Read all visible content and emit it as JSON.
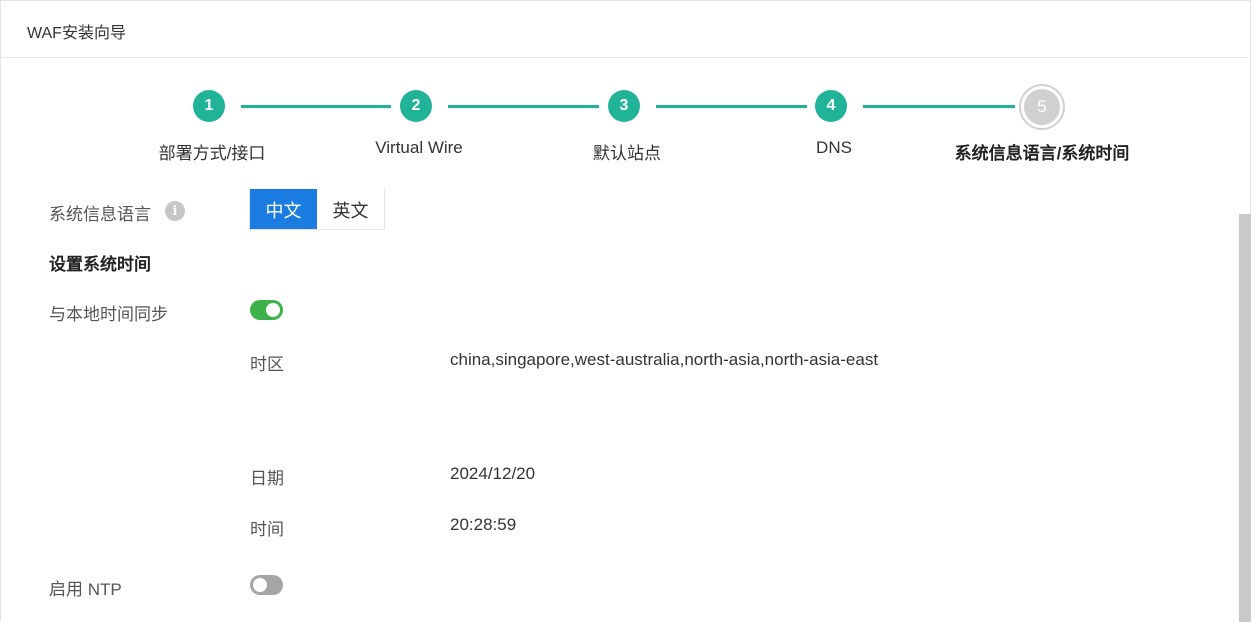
{
  "header": {
    "title": "WAF安装向导"
  },
  "steps": [
    {
      "number": "1",
      "label": "部署方式/接口",
      "state": "done"
    },
    {
      "number": "2",
      "label": "Virtual Wire",
      "state": "done"
    },
    {
      "number": "3",
      "label": "默认站点",
      "state": "done"
    },
    {
      "number": "4",
      "label": "DNS",
      "state": "done"
    },
    {
      "number": "5",
      "label": "系统信息语言/系统时间",
      "state": "current"
    }
  ],
  "colors": {
    "accent": "#20b398",
    "selected": "#1a7ce0",
    "toggle_on": "#3db24b",
    "toggle_off": "#a5a5a5",
    "pending": "#d0d0d0"
  },
  "language": {
    "label": "系统信息语言",
    "info_icon": "info-icon",
    "options": [
      "中文",
      "英文"
    ],
    "selected": "中文"
  },
  "time_section": {
    "heading": "设置系统时间",
    "sync_label": "与本地时间同步",
    "sync_enabled": true,
    "timezone_label": "时区",
    "timezone_value": "china,singapore,west-australia,north-asia,north-asia-east",
    "date_label": "日期",
    "date_value": "2024/12/20",
    "time_label": "时间",
    "time_value": "20:28:59"
  },
  "ntp": {
    "label": "启用 NTP",
    "enabled": false
  }
}
